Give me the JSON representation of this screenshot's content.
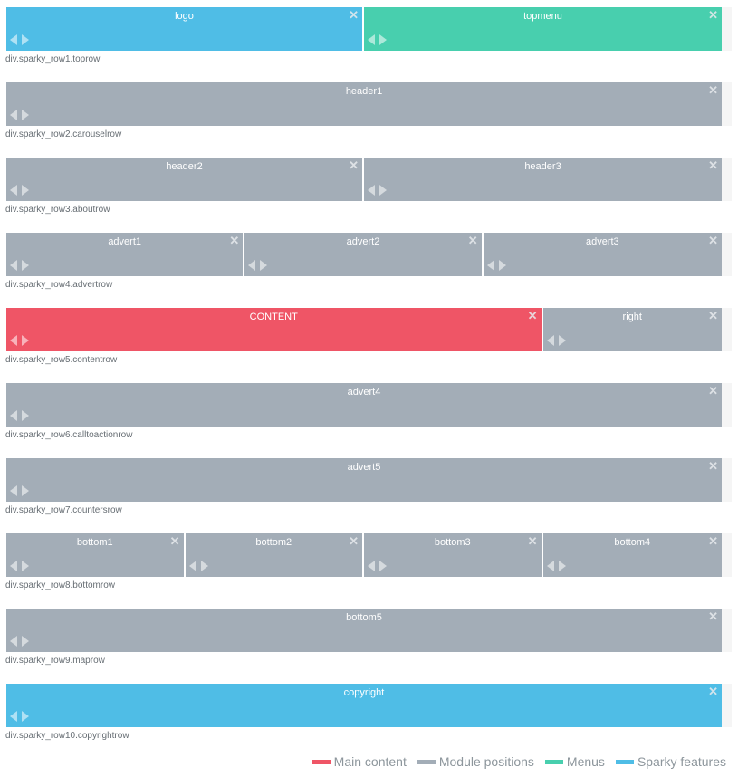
{
  "colors": {
    "main_content": "#ef5566",
    "module_positions": "#a3adb7",
    "menus": "#48cfae",
    "sparky_features": "#4fbde6"
  },
  "close_glyph": "✕",
  "rows": [
    {
      "label": "div.sparky_row1.toprow",
      "cells": [
        {
          "title": "logo",
          "type": "sparky_features",
          "span": 6
        },
        {
          "title": "topmenu",
          "type": "menus",
          "span": 6
        }
      ]
    },
    {
      "label": "div.sparky_row2.carouselrow",
      "cells": [
        {
          "title": "header1",
          "type": "module_positions",
          "span": 12
        }
      ]
    },
    {
      "label": "div.sparky_row3.aboutrow",
      "cells": [
        {
          "title": "header2",
          "type": "module_positions",
          "span": 6
        },
        {
          "title": "header3",
          "type": "module_positions",
          "span": 6
        }
      ]
    },
    {
      "label": "div.sparky_row4.advertrow",
      "cells": [
        {
          "title": "advert1",
          "type": "module_positions",
          "span": 4
        },
        {
          "title": "advert2",
          "type": "module_positions",
          "span": 4
        },
        {
          "title": "advert3",
          "type": "module_positions",
          "span": 4
        }
      ]
    },
    {
      "label": "div.sparky_row5.contentrow",
      "cells": [
        {
          "title": "CONTENT",
          "type": "main_content",
          "span": 9
        },
        {
          "title": "right",
          "type": "module_positions",
          "span": 3
        }
      ]
    },
    {
      "label": "div.sparky_row6.calltoactionrow",
      "cells": [
        {
          "title": "advert4",
          "type": "module_positions",
          "span": 12
        }
      ]
    },
    {
      "label": "div.sparky_row7.countersrow",
      "cells": [
        {
          "title": "advert5",
          "type": "module_positions",
          "span": 12
        }
      ]
    },
    {
      "label": "div.sparky_row8.bottomrow",
      "cells": [
        {
          "title": "bottom1",
          "type": "module_positions",
          "span": 3
        },
        {
          "title": "bottom2",
          "type": "module_positions",
          "span": 3
        },
        {
          "title": "bottom3",
          "type": "module_positions",
          "span": 3
        },
        {
          "title": "bottom4",
          "type": "module_positions",
          "span": 3
        }
      ]
    },
    {
      "label": "div.sparky_row9.maprow",
      "cells": [
        {
          "title": "bottom5",
          "type": "module_positions",
          "span": 12
        }
      ]
    },
    {
      "label": "div.sparky_row10.copyrightrow",
      "cells": [
        {
          "title": "copyright",
          "type": "sparky_features",
          "span": 12
        }
      ]
    }
  ],
  "legend": [
    {
      "label": "Main content",
      "type": "main_content"
    },
    {
      "label": "Module positions",
      "type": "module_positions"
    },
    {
      "label": "Menus",
      "type": "menus"
    },
    {
      "label": "Sparky features",
      "type": "sparky_features"
    }
  ]
}
